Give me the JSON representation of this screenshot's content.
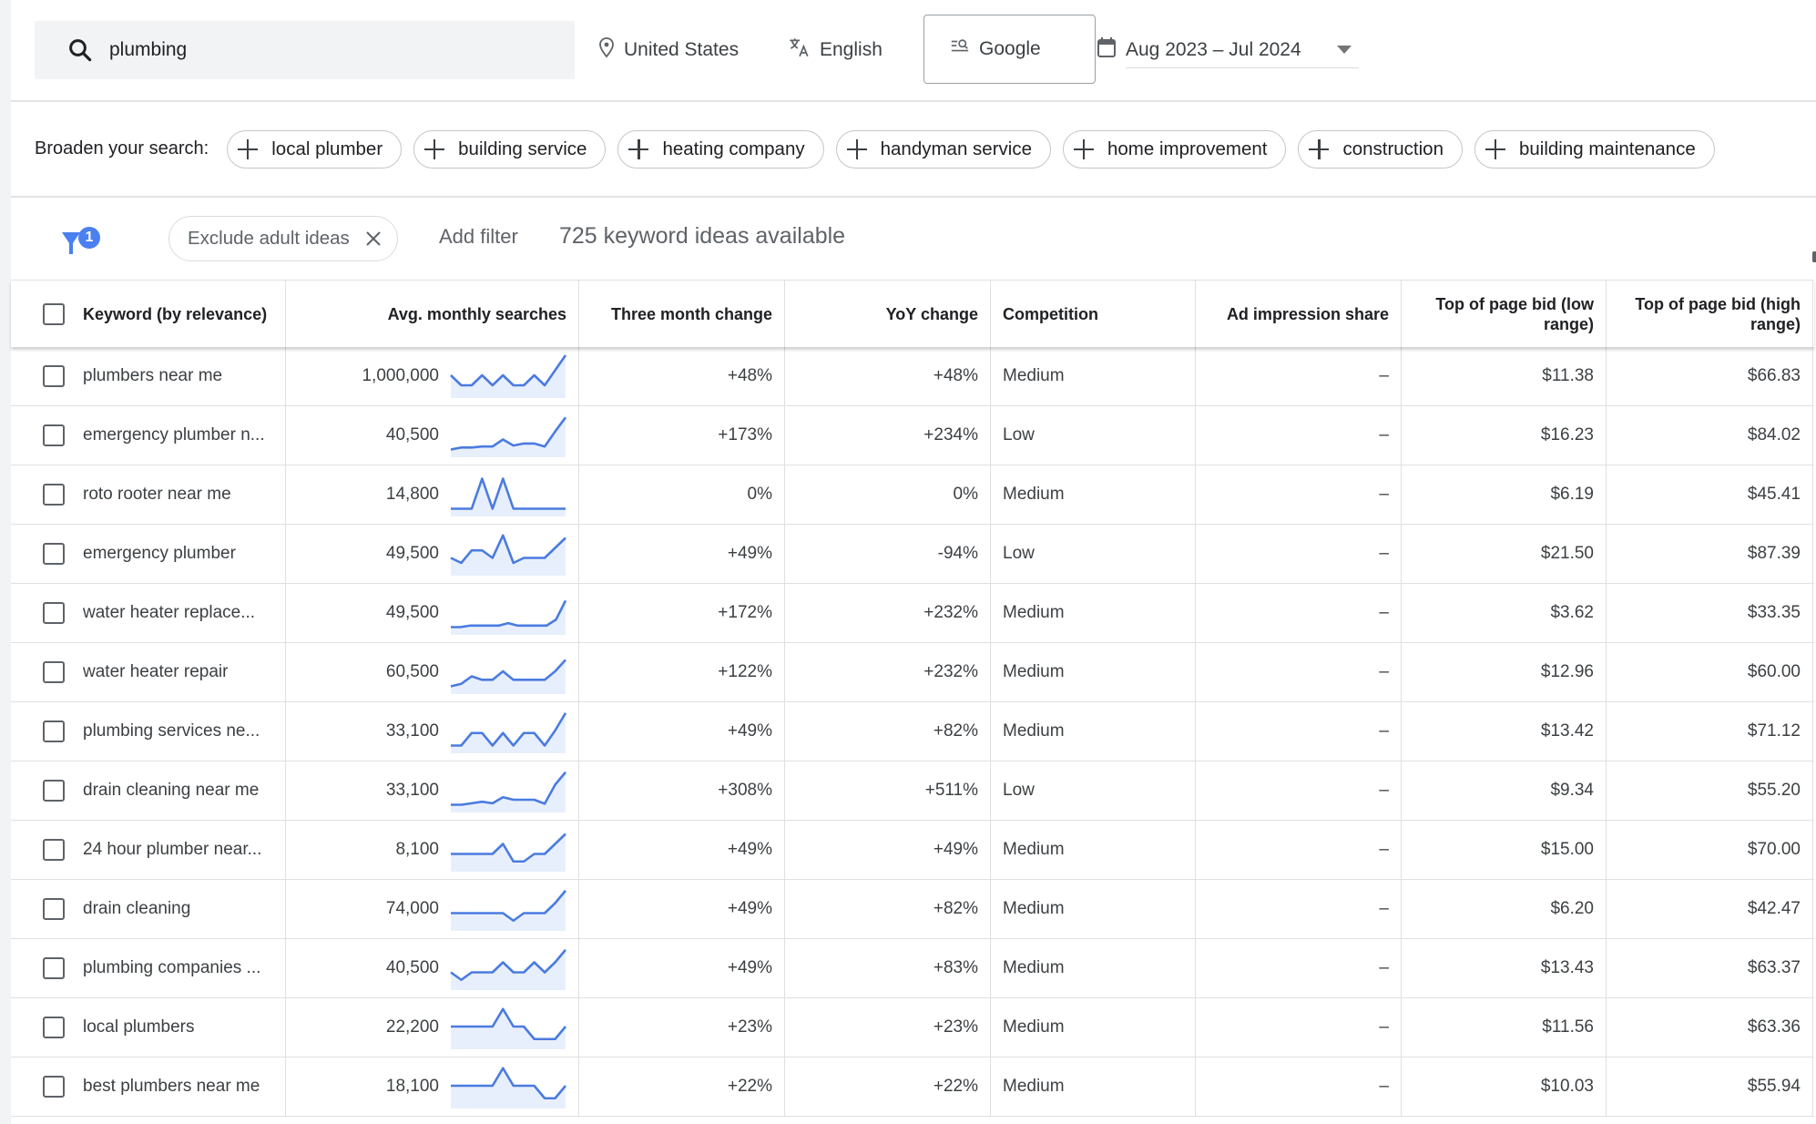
{
  "search": {
    "value": "plumbing",
    "icon": "search-icon"
  },
  "toolbar": {
    "location": "United States",
    "language": "English",
    "network": "Google",
    "date_range": "Aug 2023 – Jul 2024"
  },
  "broaden": {
    "label": "Broaden your search:",
    "chips": [
      "local plumber",
      "building service",
      "heating company",
      "handyman service",
      "home improvement",
      "construction",
      "building maintenance"
    ]
  },
  "filters": {
    "badge_count": "1",
    "active_filter": "Exclude adult ideas",
    "add_filter_label": "Add filter",
    "ideas_count": "725 keyword ideas available"
  },
  "colors": {
    "accent": "#4a80f0",
    "sparkline": "#4a7be0",
    "sparkline_fill": "#e8effc"
  },
  "table": {
    "columns": [
      "Keyword (by relevance)",
      "Avg. monthly searches",
      "Three month change",
      "YoY change",
      "Competition",
      "Ad impression share",
      "Top of page bid (low range)",
      "Top of page bid (high range)"
    ],
    "rows": [
      {
        "keyword": "plumbers near me",
        "avg": "1,000,000",
        "trend": [
          4,
          2,
          2,
          4,
          2,
          4,
          2,
          2,
          4,
          2,
          5,
          8
        ],
        "three_month": "+48%",
        "yoy": "+48%",
        "competition": "Medium",
        "ad_share": "–",
        "bid_low": "$11.38",
        "bid_high": "$66.83"
      },
      {
        "keyword": "emergency plumber n...",
        "avg": "40,500",
        "trend": [
          1,
          1.4,
          1.4,
          1.6,
          1.6,
          3,
          1.8,
          2.2,
          2.2,
          1.6,
          4.6,
          7.4
        ],
        "three_month": "+173%",
        "yoy": "+234%",
        "competition": "Low",
        "ad_share": "–",
        "bid_low": "$16.23",
        "bid_high": "$84.02"
      },
      {
        "keyword": "roto rooter near me",
        "avg": "14,800",
        "trend": [
          1,
          1,
          1,
          7,
          1,
          7,
          1,
          1,
          1,
          1,
          1,
          1
        ],
        "three_month": "0%",
        "yoy": "0%",
        "competition": "Medium",
        "ad_share": "–",
        "bid_low": "$6.19",
        "bid_high": "$45.41"
      },
      {
        "keyword": "emergency plumber",
        "avg": "49,500",
        "trend": [
          3,
          2,
          4.5,
          4.5,
          3,
          7.5,
          2,
          3,
          3,
          3,
          5,
          7
        ],
        "three_month": "+49%",
        "yoy": "-94%",
        "competition": "Low",
        "ad_share": "–",
        "bid_low": "$21.50",
        "bid_high": "$87.39"
      },
      {
        "keyword": "water heater replace...",
        "avg": "49,500",
        "trend": [
          1,
          1,
          1.3,
          1.3,
          1.3,
          1.3,
          1.8,
          1.3,
          1.3,
          1.3,
          1.3,
          2.5,
          6.3
        ],
        "three_month": "+172%",
        "yoy": "+232%",
        "competition": "Medium",
        "ad_share": "–",
        "bid_low": "$3.62",
        "bid_high": "$33.35"
      },
      {
        "keyword": "water heater repair",
        "avg": "60,500",
        "trend": [
          1,
          1.5,
          3,
          2.3,
          2.3,
          4,
          2.3,
          2.3,
          2.3,
          2.3,
          4,
          6.3
        ],
        "three_month": "+122%",
        "yoy": "+232%",
        "competition": "Medium",
        "ad_share": "–",
        "bid_low": "$12.96",
        "bid_high": "$60.00"
      },
      {
        "keyword": "plumbing services ne...",
        "avg": "33,100",
        "trend": [
          1,
          1,
          3.5,
          3.5,
          1,
          3.5,
          1,
          3.5,
          3.5,
          1,
          4,
          7.5
        ],
        "three_month": "+49%",
        "yoy": "+82%",
        "competition": "Medium",
        "ad_share": "–",
        "bid_low": "$13.42",
        "bid_high": "$71.12"
      },
      {
        "keyword": "drain cleaning near me",
        "avg": "33,100",
        "trend": [
          1,
          1,
          1.3,
          1.6,
          1.3,
          2.5,
          2,
          2,
          2,
          1.2,
          5,
          7.5
        ],
        "three_month": "+308%",
        "yoy": "+511%",
        "competition": "Low",
        "ad_share": "–",
        "bid_low": "$9.34",
        "bid_high": "$55.20"
      },
      {
        "keyword": "24 hour plumber near...",
        "avg": "8,100",
        "trend": [
          3,
          3,
          3,
          3,
          3,
          5,
          1.5,
          1.5,
          3,
          3,
          5,
          7
        ],
        "three_month": "+49%",
        "yoy": "+49%",
        "competition": "Medium",
        "ad_share": "–",
        "bid_low": "$15.00",
        "bid_high": "$70.00"
      },
      {
        "keyword": "drain cleaning",
        "avg": "74,000",
        "trend": [
          3,
          3,
          3,
          3,
          3,
          3,
          1.5,
          3,
          3,
          3,
          5,
          7.5
        ],
        "three_month": "+49%",
        "yoy": "+82%",
        "competition": "Medium",
        "ad_share": "–",
        "bid_low": "$6.20",
        "bid_high": "$42.47"
      },
      {
        "keyword": "plumbing companies ...",
        "avg": "40,500",
        "trend": [
          3,
          1.5,
          3,
          3,
          3,
          5,
          3,
          3,
          5,
          3,
          5,
          7.5
        ],
        "three_month": "+49%",
        "yoy": "+83%",
        "competition": "Medium",
        "ad_share": "–",
        "bid_low": "$13.43",
        "bid_high": "$63.37"
      },
      {
        "keyword": "local plumbers",
        "avg": "22,200",
        "trend": [
          4,
          4,
          4,
          4,
          4,
          7.5,
          4,
          4,
          1.5,
          1.5,
          1.5,
          4
        ],
        "three_month": "+23%",
        "yoy": "+23%",
        "competition": "Medium",
        "ad_share": "–",
        "bid_low": "$11.56",
        "bid_high": "$63.36"
      },
      {
        "keyword": "best plumbers near me",
        "avg": "18,100",
        "trend": [
          4,
          4,
          4,
          4,
          4,
          7.5,
          4,
          4,
          4,
          1.5,
          1.5,
          4
        ],
        "three_month": "+22%",
        "yoy": "+22%",
        "competition": "Medium",
        "ad_share": "–",
        "bid_low": "$10.03",
        "bid_high": "$55.94"
      }
    ]
  }
}
